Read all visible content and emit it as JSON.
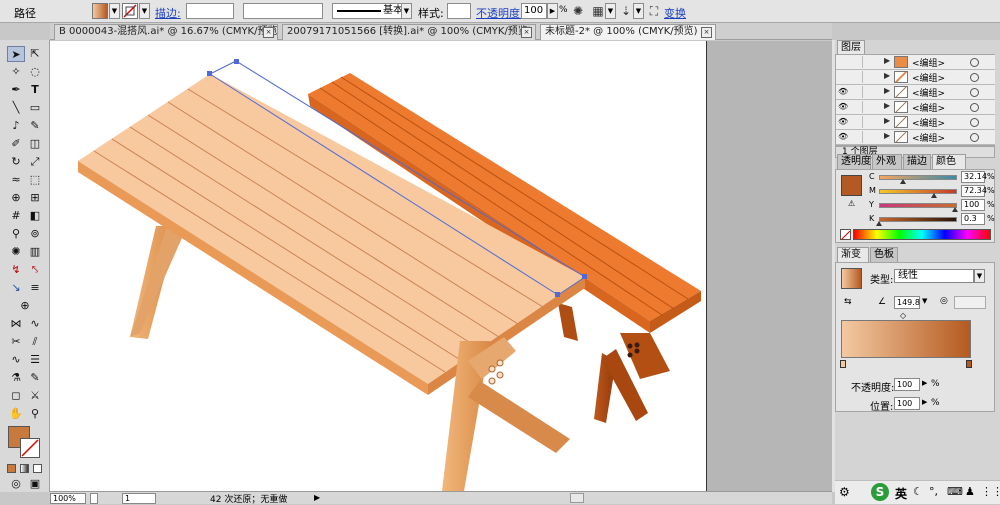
{
  "control_bar": {
    "selection_label": "路径",
    "stroke_link": "描边:",
    "stroke_style_label": "基本",
    "style_label": "样式:",
    "opacity_link": "不透明度:",
    "opacity_value": "100",
    "opacity_unit": "%",
    "transform_link": "变换"
  },
  "tabs": [
    {
      "label": "B 0000043-混搭风.ai* @ 16.67% (CMYK/预览)",
      "active": false
    },
    {
      "label": "20079171051566 [转换].ai* @ 100% (CMYK/预览)",
      "active": false
    },
    {
      "label": "未标题-2* @ 100% (CMYK/预览)",
      "active": true
    }
  ],
  "tab_close": "×",
  "status": {
    "zoom": "100%",
    "page": "1",
    "message": "42 次还原；无重做"
  },
  "layers_panel": {
    "title": "图层",
    "rows": [
      {
        "name": "<编组>",
        "visible": false
      },
      {
        "name": "<编组>",
        "visible": false
      },
      {
        "name": "<编组>",
        "visible": true
      },
      {
        "name": "<编组>",
        "visible": true
      },
      {
        "name": "<编组>",
        "visible": true
      },
      {
        "name": "<编组>",
        "visible": true
      }
    ],
    "footer": "1 个图层"
  },
  "color_panel": {
    "tabs": [
      "透明度",
      "外观",
      "描边",
      "颜色"
    ],
    "active_tab": "颜色",
    "fill_color": "#b35a24",
    "channels": [
      {
        "letter": "C",
        "value": "32.14",
        "position": 0.32
      },
      {
        "letter": "M",
        "value": "72.34",
        "position": 0.72
      },
      {
        "letter": "Y",
        "value": "100",
        "position": 1.0
      },
      {
        "letter": "K",
        "value": "0.3",
        "position": 0.003
      }
    ],
    "unit": "%"
  },
  "gradient_panel": {
    "tabs": [
      "渐变",
      "色板"
    ],
    "active_tab": "渐变",
    "type_label": "类型:",
    "type_value": "线性",
    "angle_value": "149.8",
    "start_color": "#f3c9a2",
    "end_color": "#b55a1f",
    "opacity_label": "不透明度:",
    "opacity_value": "100",
    "location_label": "位置:",
    "location_value": "100",
    "unit": "%"
  },
  "tray": {
    "ime": "英"
  },
  "colors": {
    "tabletop_light": "#f7c79c",
    "tabletop_dark": "#e5813a",
    "orange_table": "#ea762c",
    "selection": "#4f6ad8"
  }
}
